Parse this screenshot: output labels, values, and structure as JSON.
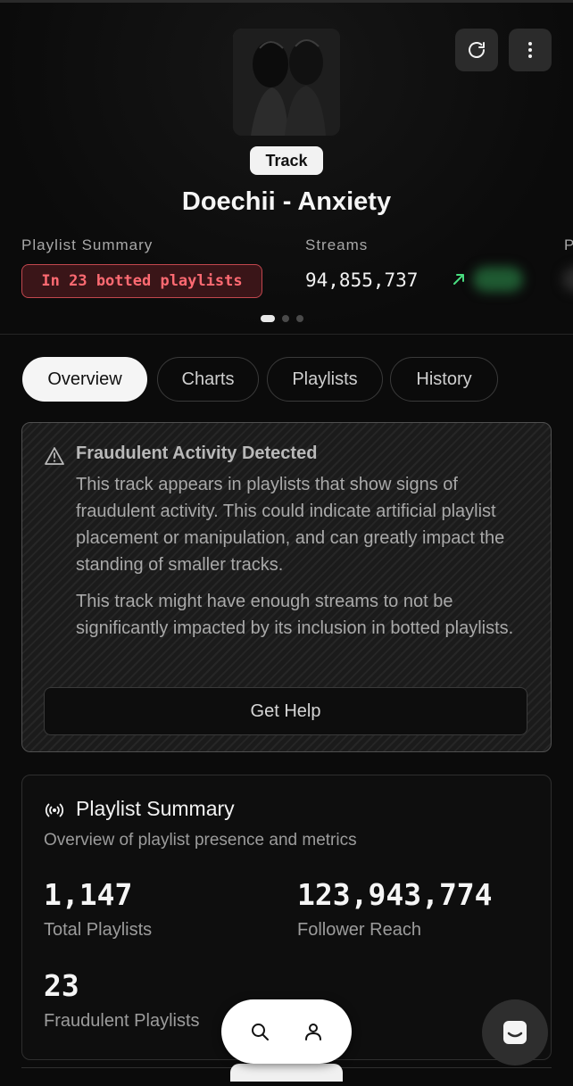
{
  "header": {
    "type_badge": "Track",
    "track_title": "Doechii - Anxiety",
    "stats": [
      {
        "label": "Playlist Summary",
        "value": "In 23 botted playlists"
      },
      {
        "label": "Streams",
        "value": "94,855,737"
      },
      {
        "label": "P"
      }
    ],
    "carousel": {
      "pages": 3,
      "active": 1
    }
  },
  "tabs": [
    "Overview",
    "Charts",
    "Playlists",
    "History"
  ],
  "alert": {
    "title": "Fraudulent Activity Detected",
    "body": "This track appears in playlists that show signs of fraudulent activity. This could indicate artificial playlist placement or manipulation, and can greatly impact the standing of smaller tracks.",
    "note": "This track might have enough streams to not be significantly impacted by its inclusion in botted playlists.",
    "button": "Get Help"
  },
  "summary": {
    "title": "Playlist Summary",
    "subtitle": "Overview of playlist presence and metrics",
    "metrics": [
      {
        "value": "1,147",
        "label": "Total Playlists"
      },
      {
        "value": "123,943,774",
        "label": "Follower Reach"
      },
      {
        "value": "23",
        "label": "Fraudulent Playlists"
      }
    ]
  },
  "colors": {
    "background": "#0b0b0b",
    "danger": "#ff6a72",
    "trend_up": "#4ade80",
    "accent_light": "#f5f5f5"
  },
  "icons": {
    "refresh": "refresh-icon",
    "more": "more-vertical-icon",
    "trend": "trend-up-icon",
    "warning": "warning-icon",
    "broadcast": "broadcast-icon",
    "search": "search-icon",
    "user": "user-icon",
    "chat": "chat-icon"
  }
}
